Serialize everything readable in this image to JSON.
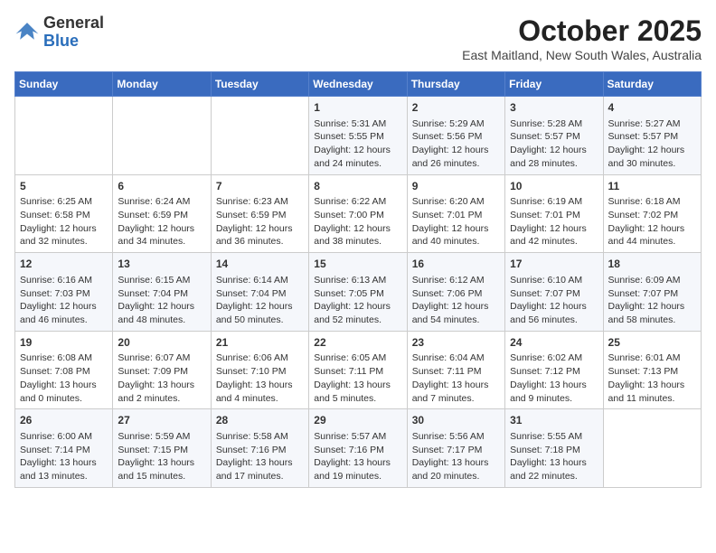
{
  "header": {
    "logo_general": "General",
    "logo_blue": "Blue",
    "month": "October 2025",
    "location": "East Maitland, New South Wales, Australia"
  },
  "weekdays": [
    "Sunday",
    "Monday",
    "Tuesday",
    "Wednesday",
    "Thursday",
    "Friday",
    "Saturday"
  ],
  "weeks": [
    [
      {
        "day": "",
        "content": ""
      },
      {
        "day": "",
        "content": ""
      },
      {
        "day": "",
        "content": ""
      },
      {
        "day": "1",
        "content": "Sunrise: 5:31 AM\nSunset: 5:55 PM\nDaylight: 12 hours\nand 24 minutes."
      },
      {
        "day": "2",
        "content": "Sunrise: 5:29 AM\nSunset: 5:56 PM\nDaylight: 12 hours\nand 26 minutes."
      },
      {
        "day": "3",
        "content": "Sunrise: 5:28 AM\nSunset: 5:57 PM\nDaylight: 12 hours\nand 28 minutes."
      },
      {
        "day": "4",
        "content": "Sunrise: 5:27 AM\nSunset: 5:57 PM\nDaylight: 12 hours\nand 30 minutes."
      }
    ],
    [
      {
        "day": "5",
        "content": "Sunrise: 6:25 AM\nSunset: 6:58 PM\nDaylight: 12 hours\nand 32 minutes."
      },
      {
        "day": "6",
        "content": "Sunrise: 6:24 AM\nSunset: 6:59 PM\nDaylight: 12 hours\nand 34 minutes."
      },
      {
        "day": "7",
        "content": "Sunrise: 6:23 AM\nSunset: 6:59 PM\nDaylight: 12 hours\nand 36 minutes."
      },
      {
        "day": "8",
        "content": "Sunrise: 6:22 AM\nSunset: 7:00 PM\nDaylight: 12 hours\nand 38 minutes."
      },
      {
        "day": "9",
        "content": "Sunrise: 6:20 AM\nSunset: 7:01 PM\nDaylight: 12 hours\nand 40 minutes."
      },
      {
        "day": "10",
        "content": "Sunrise: 6:19 AM\nSunset: 7:01 PM\nDaylight: 12 hours\nand 42 minutes."
      },
      {
        "day": "11",
        "content": "Sunrise: 6:18 AM\nSunset: 7:02 PM\nDaylight: 12 hours\nand 44 minutes."
      }
    ],
    [
      {
        "day": "12",
        "content": "Sunrise: 6:16 AM\nSunset: 7:03 PM\nDaylight: 12 hours\nand 46 minutes."
      },
      {
        "day": "13",
        "content": "Sunrise: 6:15 AM\nSunset: 7:04 PM\nDaylight: 12 hours\nand 48 minutes."
      },
      {
        "day": "14",
        "content": "Sunrise: 6:14 AM\nSunset: 7:04 PM\nDaylight: 12 hours\nand 50 minutes."
      },
      {
        "day": "15",
        "content": "Sunrise: 6:13 AM\nSunset: 7:05 PM\nDaylight: 12 hours\nand 52 minutes."
      },
      {
        "day": "16",
        "content": "Sunrise: 6:12 AM\nSunset: 7:06 PM\nDaylight: 12 hours\nand 54 minutes."
      },
      {
        "day": "17",
        "content": "Sunrise: 6:10 AM\nSunset: 7:07 PM\nDaylight: 12 hours\nand 56 minutes."
      },
      {
        "day": "18",
        "content": "Sunrise: 6:09 AM\nSunset: 7:07 PM\nDaylight: 12 hours\nand 58 minutes."
      }
    ],
    [
      {
        "day": "19",
        "content": "Sunrise: 6:08 AM\nSunset: 7:08 PM\nDaylight: 13 hours\nand 0 minutes."
      },
      {
        "day": "20",
        "content": "Sunrise: 6:07 AM\nSunset: 7:09 PM\nDaylight: 13 hours\nand 2 minutes."
      },
      {
        "day": "21",
        "content": "Sunrise: 6:06 AM\nSunset: 7:10 PM\nDaylight: 13 hours\nand 4 minutes."
      },
      {
        "day": "22",
        "content": "Sunrise: 6:05 AM\nSunset: 7:11 PM\nDaylight: 13 hours\nand 5 minutes."
      },
      {
        "day": "23",
        "content": "Sunrise: 6:04 AM\nSunset: 7:11 PM\nDaylight: 13 hours\nand 7 minutes."
      },
      {
        "day": "24",
        "content": "Sunrise: 6:02 AM\nSunset: 7:12 PM\nDaylight: 13 hours\nand 9 minutes."
      },
      {
        "day": "25",
        "content": "Sunrise: 6:01 AM\nSunset: 7:13 PM\nDaylight: 13 hours\nand 11 minutes."
      }
    ],
    [
      {
        "day": "26",
        "content": "Sunrise: 6:00 AM\nSunset: 7:14 PM\nDaylight: 13 hours\nand 13 minutes."
      },
      {
        "day": "27",
        "content": "Sunrise: 5:59 AM\nSunset: 7:15 PM\nDaylight: 13 hours\nand 15 minutes."
      },
      {
        "day": "28",
        "content": "Sunrise: 5:58 AM\nSunset: 7:16 PM\nDaylight: 13 hours\nand 17 minutes."
      },
      {
        "day": "29",
        "content": "Sunrise: 5:57 AM\nSunset: 7:16 PM\nDaylight: 13 hours\nand 19 minutes."
      },
      {
        "day": "30",
        "content": "Sunrise: 5:56 AM\nSunset: 7:17 PM\nDaylight: 13 hours\nand 20 minutes."
      },
      {
        "day": "31",
        "content": "Sunrise: 5:55 AM\nSunset: 7:18 PM\nDaylight: 13 hours\nand 22 minutes."
      },
      {
        "day": "",
        "content": ""
      }
    ]
  ]
}
